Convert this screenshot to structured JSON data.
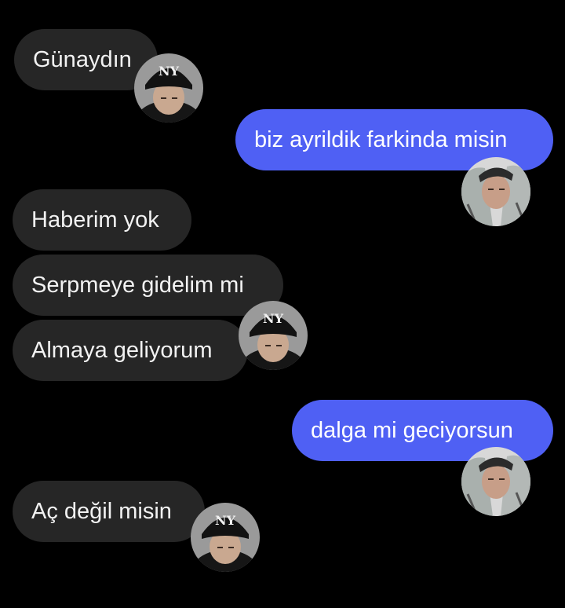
{
  "messages": [
    {
      "sender": "them",
      "text": "Günaydın"
    },
    {
      "sender": "me",
      "text": "biz ayrildik farkinda misin"
    },
    {
      "sender": "them",
      "text": "Haberim yok"
    },
    {
      "sender": "them",
      "text": "Serpmeye gidelim mi"
    },
    {
      "sender": "them",
      "text": "Almaya geliyorum"
    },
    {
      "sender": "me",
      "text": "dalga mi geciyorsun"
    },
    {
      "sender": "them",
      "text": "Aç değil misin"
    }
  ],
  "colors": {
    "background": "#000000",
    "incoming_bubble": "#262626",
    "outgoing_bubble": "#4f60f4",
    "text": "#f2f2f2"
  },
  "icons": {
    "sender_avatar": "contact-avatar-black-beanie",
    "my_avatar": "user-avatar-grey-hood"
  }
}
